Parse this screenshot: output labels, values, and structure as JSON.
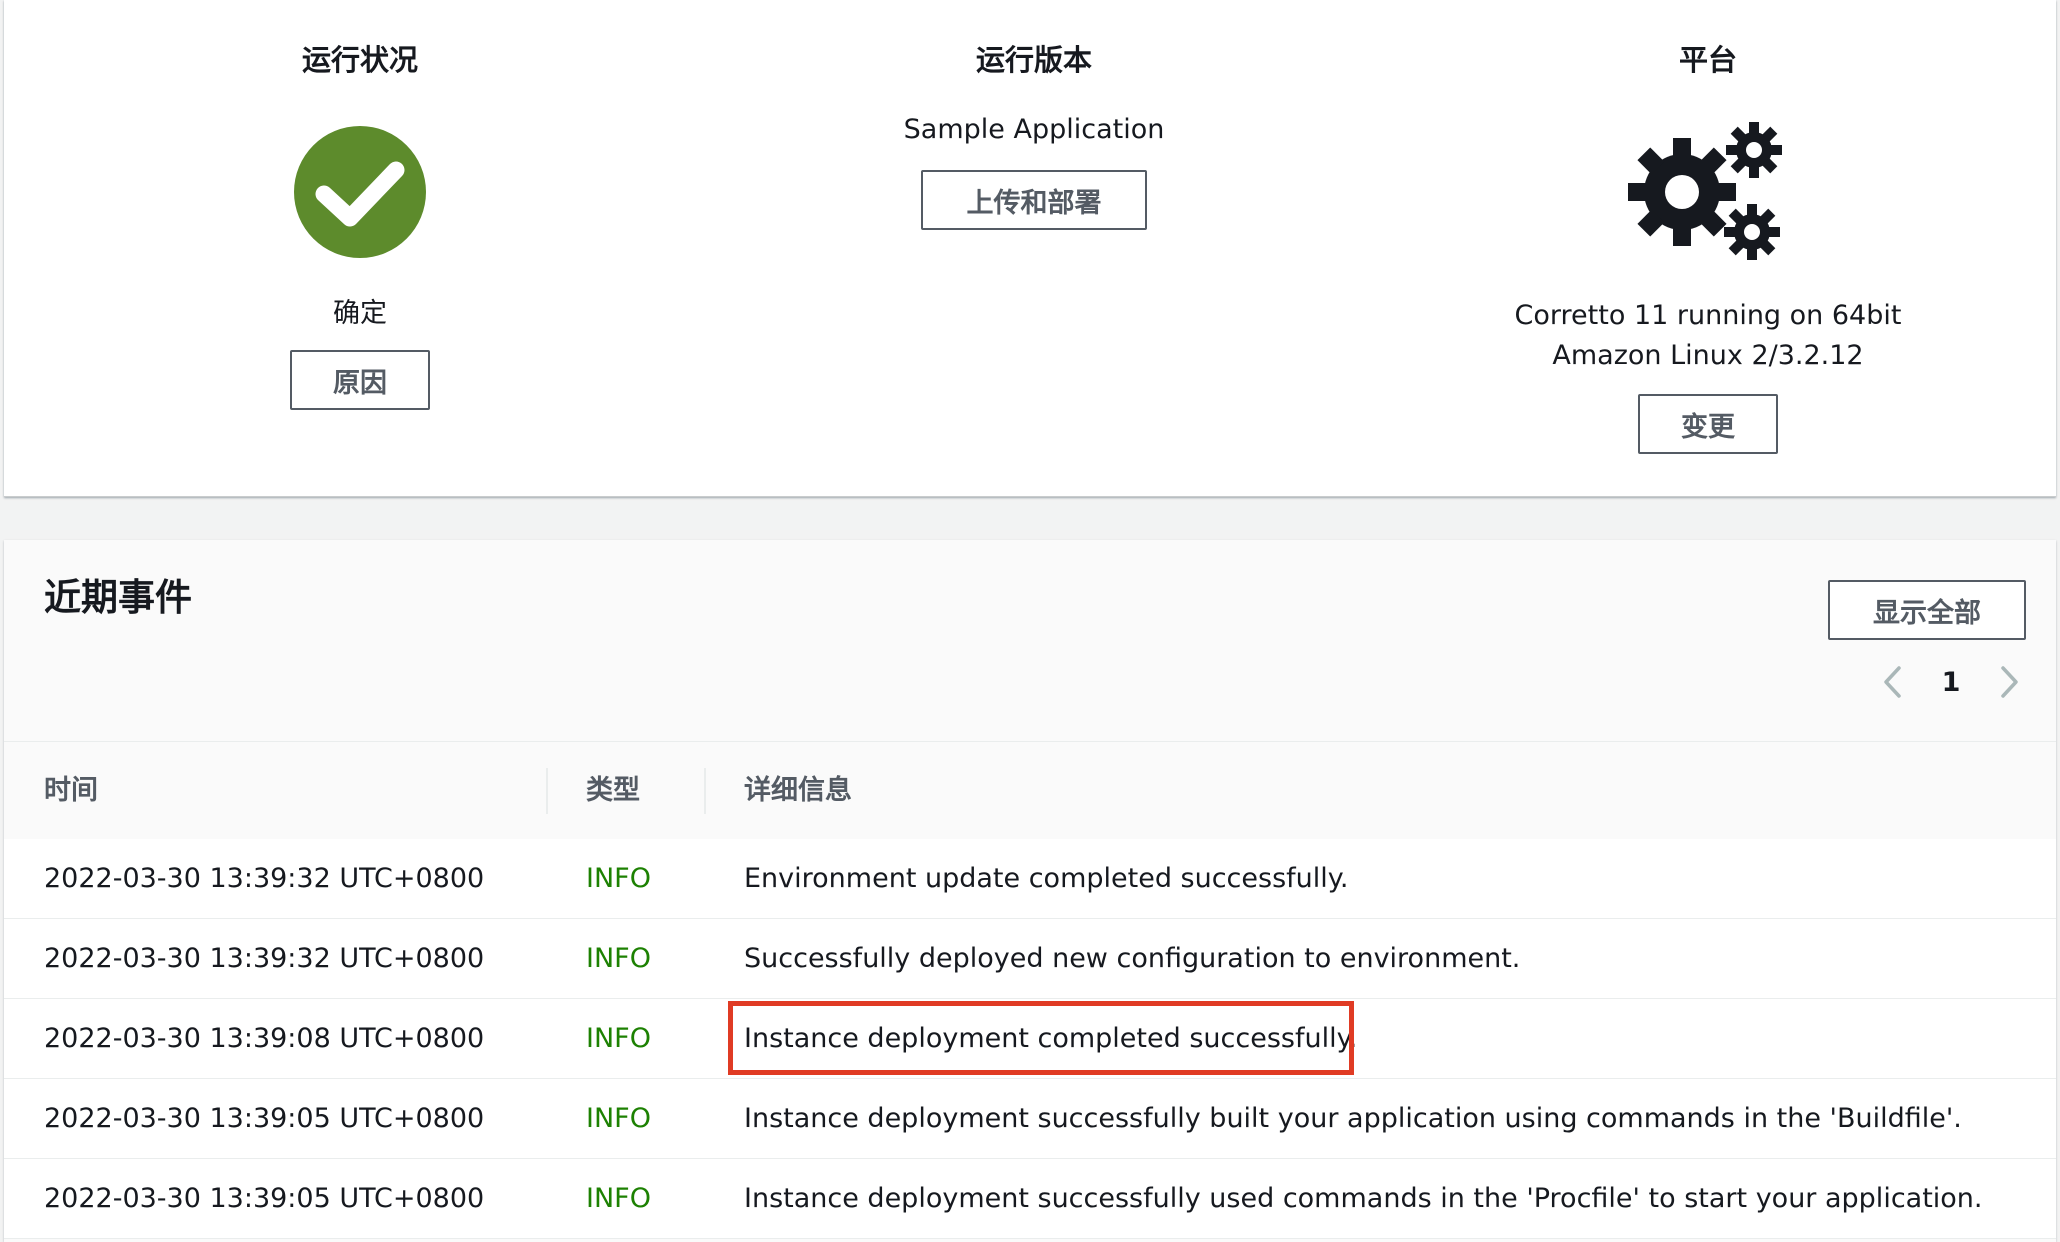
{
  "summary": {
    "health": {
      "title": "运行状况",
      "status": "确定",
      "button": "原因",
      "icon": "check-circle-icon",
      "color": "#5d8b2c"
    },
    "version": {
      "title": "运行版本",
      "name": "Sample Application",
      "button": "上传和部署"
    },
    "platform": {
      "title": "平台",
      "line1": "Corretto 11 running on 64bit",
      "line2": "Amazon Linux 2/3.2.12",
      "button": "变更",
      "icon": "gears-icon"
    }
  },
  "events": {
    "title": "近期事件",
    "show_all": "显示全部",
    "pagination": {
      "current_page": "1"
    },
    "columns": {
      "time": "时间",
      "type": "类型",
      "detail": "详细信息"
    },
    "rows": [
      {
        "time": "2022-03-30 13:39:32 UTC+0800",
        "type": "INFO",
        "detail": "Environment update completed successfully."
      },
      {
        "time": "2022-03-30 13:39:32 UTC+0800",
        "type": "INFO",
        "detail": "Successfully deployed new configuration to environment."
      },
      {
        "time": "2022-03-30 13:39:08 UTC+0800",
        "type": "INFO",
        "detail": "Instance deployment completed successfully."
      },
      {
        "time": "2022-03-30 13:39:05 UTC+0800",
        "type": "INFO",
        "detail": "Instance deployment successfully built your application using commands in the 'Buildfile'."
      },
      {
        "time": "2022-03-30 13:39:05 UTC+0800",
        "type": "INFO",
        "detail": "Instance deployment successfully used commands in the 'Procfile' to start your application."
      }
    ],
    "highlighted_row": 2,
    "info_color": "#1d8102",
    "highlight_color": "#e03b24"
  }
}
